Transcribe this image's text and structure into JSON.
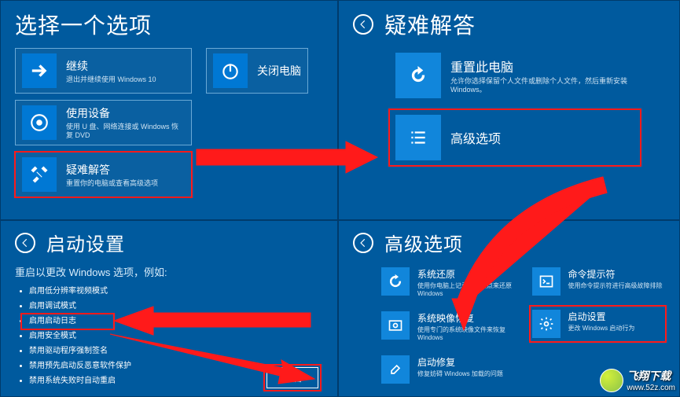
{
  "panel1": {
    "title": "选择一个选项",
    "tiles": {
      "continue": {
        "label": "继续",
        "desc": "退出并继续使用 Windows 10"
      },
      "device": {
        "label": "使用设备",
        "desc": "使用 U 盘、网络连接或 Windows 恢复 DVD"
      },
      "troubleshoot": {
        "label": "疑难解答",
        "desc": "重置你的电脑或查看高级选项"
      },
      "shutdown": {
        "label": "关闭电脑"
      }
    }
  },
  "panel2": {
    "title": "疑难解答",
    "tiles": {
      "reset": {
        "label": "重置此电脑",
        "desc": "允许你选择保留个人文件或删除个人文件，然后重新安装 Windows。"
      },
      "advanced": {
        "label": "高级选项"
      }
    }
  },
  "panel3": {
    "title": "启动设置",
    "subhead": "重启以更改 Windows 选项，例如:",
    "items": [
      "启用低分辨率视频模式",
      "启用调试模式",
      "启用启动日志",
      "启用安全模式",
      "禁用驱动程序强制签名",
      "禁用预先启动反恶意软件保护",
      "禁用系统失败时自动重启"
    ],
    "restart": "重启"
  },
  "panel4": {
    "title": "高级选项",
    "left": {
      "restore": {
        "label": "系统还原",
        "desc": "使用你电脑上记录的还原点来还原 Windows"
      },
      "image": {
        "label": "系统映像恢复",
        "desc": "使用专门的系统映像文件来恢复 Windows"
      },
      "repair": {
        "label": "启动修复",
        "desc": "修复妨碍 Windows 加载的问题"
      }
    },
    "right": {
      "cmd": {
        "label": "命令提示符",
        "desc": "使用命令提示符进行高级故障排除"
      },
      "startup": {
        "label": "启动设置",
        "desc": "更改 Windows 启动行为"
      }
    }
  },
  "watermark": {
    "text": "飞翔下载",
    "url": "www.52z.com"
  }
}
